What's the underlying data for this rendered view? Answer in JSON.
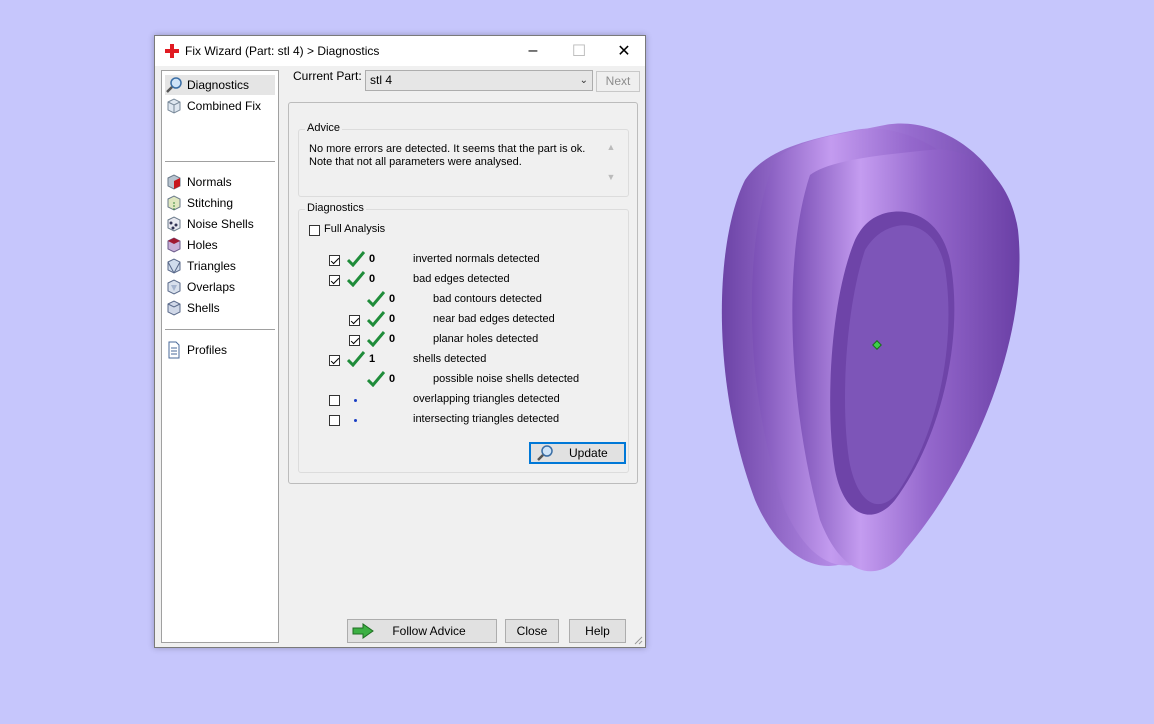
{
  "window": {
    "title": "Fix Wizard (Part: stl 4) > Diagnostics",
    "controls": {
      "minimize": "–",
      "maximize": "☐",
      "close": "✕"
    }
  },
  "sidebar": {
    "items": [
      {
        "label": "Diagnostics",
        "icon": "magnifier-icon",
        "selected": true
      },
      {
        "label": "Combined Fix",
        "icon": "cube-icon"
      },
      {
        "label": "Normals",
        "icon": "normals-cube-icon"
      },
      {
        "label": "Stitching",
        "icon": "stitching-cube-icon"
      },
      {
        "label": "Noise Shells",
        "icon": "noise-shells-icon"
      },
      {
        "label": "Holes",
        "icon": "holes-cube-icon"
      },
      {
        "label": "Triangles",
        "icon": "triangles-cube-icon"
      },
      {
        "label": "Overlaps",
        "icon": "overlaps-cube-icon"
      },
      {
        "label": "Shells",
        "icon": "shells-cube-icon"
      },
      {
        "label": "Profiles",
        "icon": "document-icon"
      }
    ]
  },
  "current_part": {
    "label": "Current Part:",
    "value": "stl 4"
  },
  "next_label": "Next",
  "advice": {
    "title": "Advice",
    "line1": "No more errors are detected. It seems that the part is ok.",
    "line2": "Note that not all parameters were analysed."
  },
  "diagnostics": {
    "title": "Diagnostics",
    "full_analysis": "Full Analysis",
    "rows": [
      {
        "checked": true,
        "status": "ok",
        "count": "0",
        "text": "inverted normals detected"
      },
      {
        "checked": true,
        "status": "ok",
        "count": "0",
        "text": "bad edges detected"
      },
      {
        "checked": null,
        "status": "ok",
        "count": "0",
        "text": "bad contours detected"
      },
      {
        "checked": true,
        "status": "ok",
        "count": "0",
        "text": "near bad edges detected"
      },
      {
        "checked": true,
        "status": "ok",
        "count": "0",
        "text": "planar holes detected"
      },
      {
        "checked": true,
        "status": "ok",
        "count": "1",
        "text": "shells detected"
      },
      {
        "checked": null,
        "status": "ok",
        "count": "0",
        "text": "possible noise shells detected"
      },
      {
        "checked": false,
        "status": "not-analysed",
        "count": "",
        "text": "overlapping triangles detected"
      },
      {
        "checked": false,
        "status": "not-analysed",
        "count": "",
        "text": "intersecting triangles detected"
      }
    ],
    "update_label": "Update"
  },
  "footer": {
    "follow_advice": "Follow Advice",
    "close": "Close",
    "help": "Help"
  },
  "colors": {
    "background": "#c6c6fc",
    "model": "#9a6fd0",
    "check": "#1f8c3a",
    "accent": "#0078d7"
  }
}
